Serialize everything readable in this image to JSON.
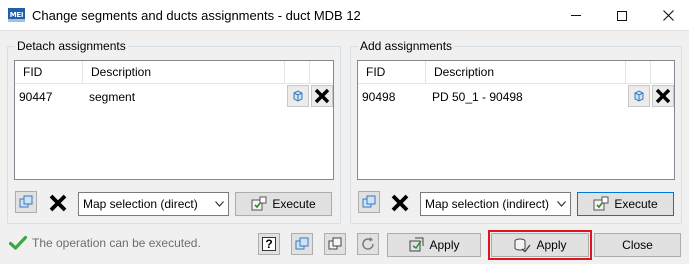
{
  "window": {
    "title": "Change segments and ducts assignments - duct MDB 12",
    "app_icon_text": "MEI"
  },
  "detach": {
    "group_label": "Detach assignments",
    "columns": [
      "FID",
      "Description"
    ],
    "rows": [
      {
        "fid": "90447",
        "description": "segment"
      }
    ],
    "selection_mode": "Map selection (direct)",
    "execute_label": "Execute"
  },
  "add": {
    "group_label": "Add assignments",
    "columns": [
      "FID",
      "Description"
    ],
    "rows": [
      {
        "fid": "90498",
        "description": "PD 50_1 - 90498"
      }
    ],
    "selection_mode": "Map selection (indirect)",
    "execute_label": "Execute"
  },
  "footer": {
    "status_text": "The operation can be executed.",
    "help_glyph": "?",
    "apply_label": "Apply",
    "apply_selected_label": "Apply",
    "close_label": "Close"
  },
  "colors": {
    "accent_blue": "#0078d7",
    "highlight_red": "#e0141e",
    "status_green": "#3aa845"
  }
}
